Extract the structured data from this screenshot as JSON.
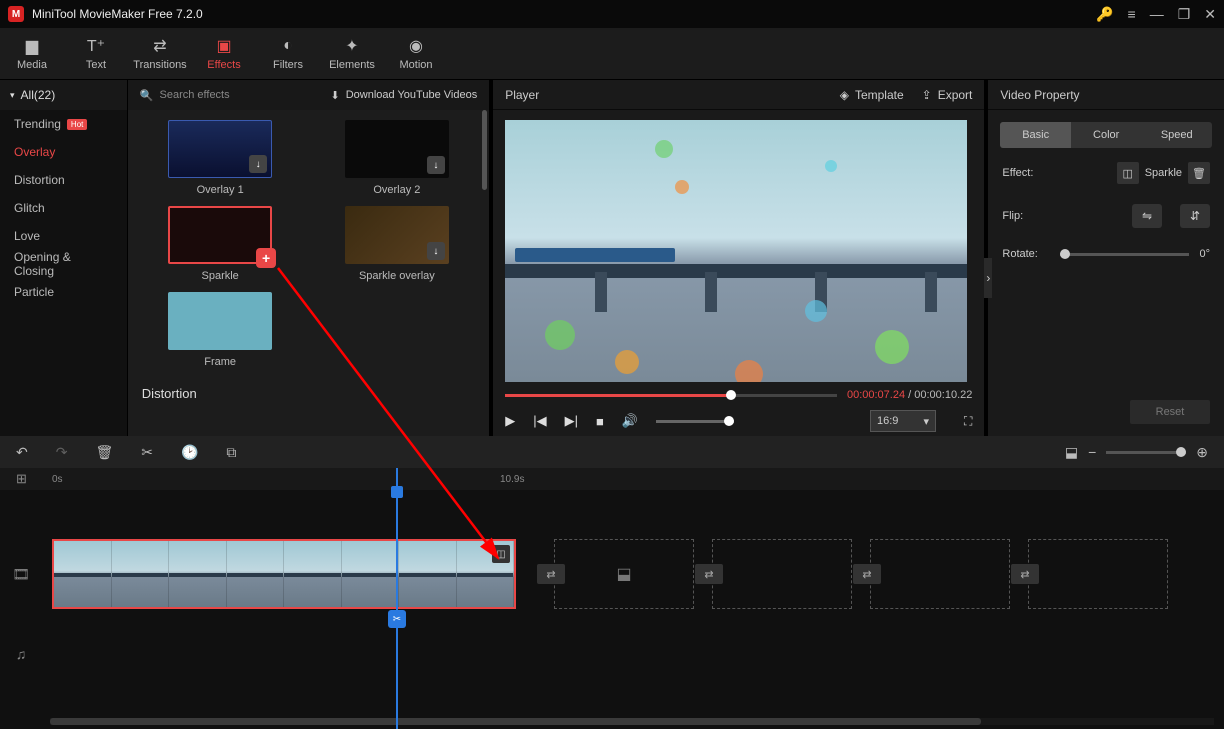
{
  "titlebar": {
    "app_name": "MiniTool MovieMaker Free 7.2.0"
  },
  "toolbar": {
    "media": "Media",
    "text": "Text",
    "transitions": "Transitions",
    "effects": "Effects",
    "filters": "Filters",
    "elements": "Elements",
    "motion": "Motion"
  },
  "sidebar": {
    "all": "All(22)",
    "items": [
      {
        "label": "Trending",
        "hot": "Hot"
      },
      {
        "label": "Overlay"
      },
      {
        "label": "Distortion"
      },
      {
        "label": "Glitch"
      },
      {
        "label": "Love"
      },
      {
        "label": "Opening & Closing"
      },
      {
        "label": "Particle"
      }
    ]
  },
  "effects_panel": {
    "search_placeholder": "Search effects",
    "download_link": "Download YouTube Videos",
    "section_title": "Distortion",
    "cards": [
      {
        "name": "Overlay 1"
      },
      {
        "name": "Overlay 2"
      },
      {
        "name": "Sparkle"
      },
      {
        "name": "Sparkle overlay"
      },
      {
        "name": "Frame"
      }
    ]
  },
  "player": {
    "title": "Player",
    "template_btn": "Template",
    "export_btn": "Export",
    "time_current": "00:00:07.24",
    "time_sep": " / ",
    "time_total": "00:00:10.22",
    "aspect": "16:9"
  },
  "props": {
    "title": "Video Property",
    "tabs": {
      "basic": "Basic",
      "color": "Color",
      "speed": "Speed"
    },
    "effect_label": "Effect:",
    "effect_value": "Sparkle",
    "flip_label": "Flip:",
    "rotate_label": "Rotate:",
    "rotate_value": "0°",
    "reset": "Reset"
  },
  "timeline": {
    "tick0": "0s",
    "tick1": "10.9s"
  }
}
